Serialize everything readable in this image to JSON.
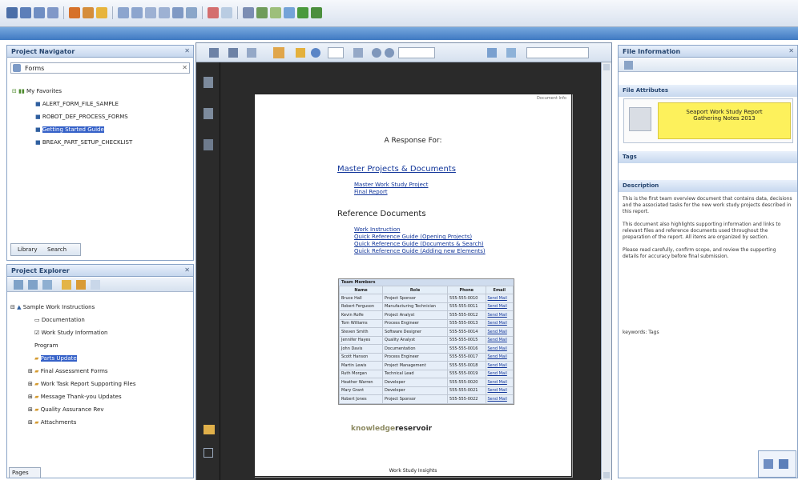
{
  "tabs": {
    "left_bottom": "Pages",
    "library": "Library",
    "search": "Search"
  },
  "panels": {
    "navigator": "Project Navigator",
    "explorer": "Project Explorer",
    "file_info": "File Information",
    "tags": "Tags",
    "description": "Description",
    "file_attributes": "File Attributes"
  },
  "navigator": {
    "search_value": "Forms",
    "root": "My Favorites",
    "items": [
      "ALERT_FORM_FILE_SAMPLE",
      "ROBOT_DEF_PROCESS_FORMS",
      "Getting Started Guide",
      "BREAK_PART_SETUP_CHECKLIST"
    ]
  },
  "explorer": {
    "root": "Sample Work Instructions",
    "items": [
      "Documentation",
      "Work Study Information",
      "Program",
      "Parts Update",
      "Final Assessment Forms",
      "Work Task Report Supporting Files",
      "Message Thank-you Updates",
      "Quality Assurance Rev",
      "Attachments"
    ]
  },
  "document": {
    "header_text": "Document Info",
    "title": "A Response For:",
    "section1": "Master Projects & Documents",
    "links1": [
      "Master Work Study Project",
      "Final Report"
    ],
    "section2": "Reference Documents",
    "links2": [
      "Work Instruction",
      "Quick Reference Guide (Opening Projects)",
      "Quick Reference Guide (Documents & Search)",
      "Quick Reference Guide (Adding new Elements)"
    ],
    "table_title": "Team Members",
    "columns": [
      "Name",
      "Role",
      "Phone",
      "Email"
    ],
    "rows": [
      [
        "Bruce Hall",
        "Project Sponsor",
        "555-555-0010",
        "Send Mail"
      ],
      [
        "Robert Ferguson",
        "Manufacturing Technician",
        "555-555-0011",
        "Send Mail"
      ],
      [
        "Kevin Rolfe",
        "Project Analyst",
        "555-555-0012",
        "Send Mail"
      ],
      [
        "Tom Williams",
        "Process Engineer",
        "555-555-0013",
        "Send Mail"
      ],
      [
        "Steven Smith",
        "Software Designer",
        "555-555-0014",
        "Send Mail"
      ],
      [
        "Jennifer Hayes",
        "Quality Analyst",
        "555-555-0015",
        "Send Mail"
      ],
      [
        "John Davis",
        "Documentation",
        "555-555-0016",
        "Send Mail"
      ],
      [
        "Scott Hanson",
        "Process Engineer",
        "555-555-0017",
        "Send Mail"
      ],
      [
        "Martin Lewis",
        "Project Management",
        "555-555-0018",
        "Send Mail"
      ],
      [
        "Ruth Morgan",
        "Technical Lead",
        "555-555-0019",
        "Send Mail"
      ],
      [
        "Heather Warren",
        "Developer",
        "555-555-0020",
        "Send Mail"
      ],
      [
        "Mary Grant",
        "Developer",
        "555-555-0021",
        "Send Mail"
      ],
      [
        "Robert Jones",
        "Project Sponsor",
        "555-555-0022",
        "Send Mail"
      ]
    ],
    "logo_left": "knowledge",
    "logo_right": "reservoir",
    "footer": "Work Study Insights"
  },
  "file_attr": {
    "line1": "Seaport Work Study Report",
    "line2": "Gathering Notes 2013"
  },
  "description": "This is the first team overview document that contains data, decisions and the associated tasks for the new work study projects described in this report.\n\nThis document also highlights supporting information and links to relevant files and reference documents used throughout the preparation of the report. All items are organized by section.\n\nPlease read carefully, confirm scope, and review the supporting details for accuracy before final submission.",
  "keywords": "keywords: Tags",
  "colors": {
    "menubar": "#3f79c2",
    "highlight": "#3561c8",
    "link": "#12369a"
  }
}
